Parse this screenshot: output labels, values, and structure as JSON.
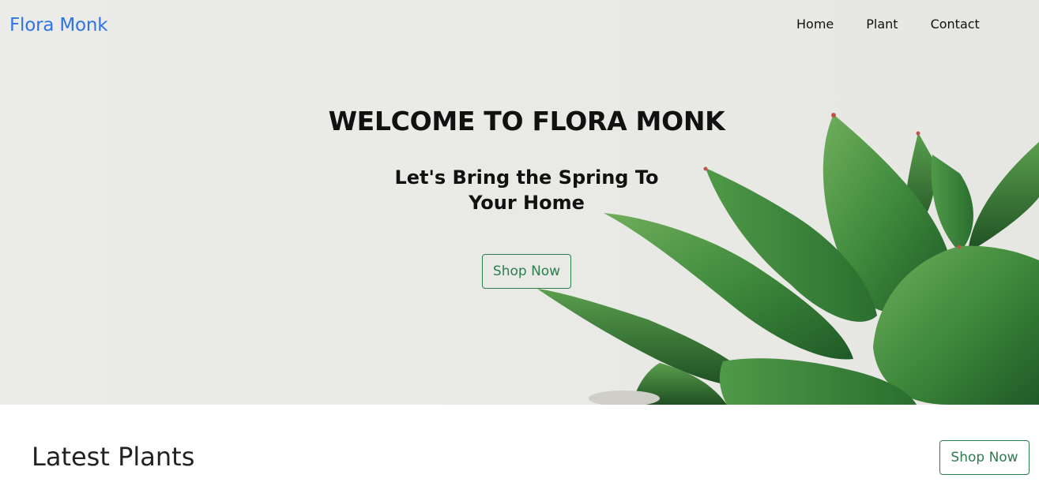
{
  "navbar": {
    "brand": "Flora Monk",
    "links": [
      "Home",
      "Plant",
      "Contact"
    ]
  },
  "hero": {
    "title": "WELCOME TO FLORA MONK",
    "subtitle_line1": "Let's Bring the Spring To",
    "subtitle_line2": "Your Home",
    "button_label": "Shop Now"
  },
  "latest": {
    "title": "Latest Plants",
    "button_label": "Shop Now"
  },
  "colors": {
    "brand": "#2f74e4",
    "accent_green": "#2e7d4f",
    "hero_bg": "#e9e9e6"
  }
}
